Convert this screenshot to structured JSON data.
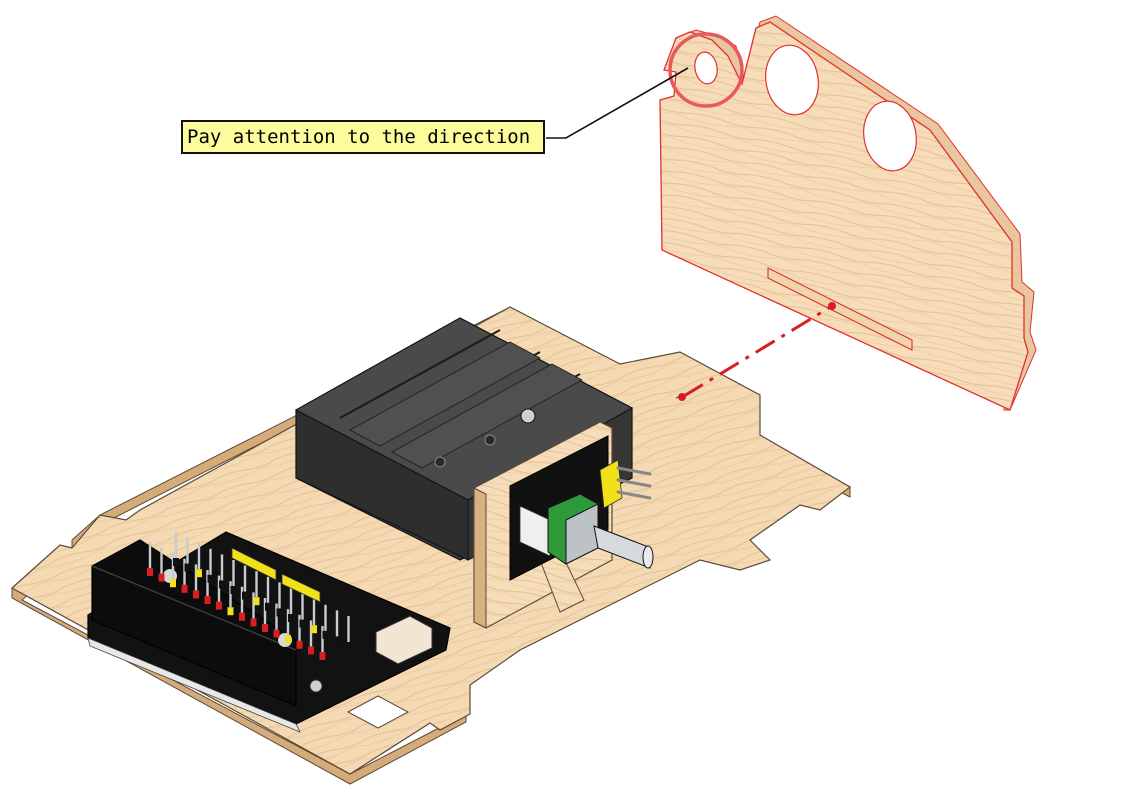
{
  "annotation": {
    "label": "Pay attention to the direction"
  },
  "colors": {
    "background": "#ffffff",
    "wood": "#f4d9b2",
    "wood_grain": "#dcb98e",
    "wood_edge": "#c9a070",
    "highlight_red": "#e03030",
    "battery_holder": "#3c3c3c",
    "board_black": "#151515",
    "pin_yellow": "#f2e01a",
    "pin_red": "#d81e1e",
    "pot_green": "#2e9a3a",
    "metal": "#bfc4c8",
    "callout_fill": "#fcfc9c"
  },
  "parts": {
    "base_plate": "wood-base-plate",
    "side_panel": "wood-side-panel",
    "battery_holder": "battery-holder",
    "expansion_board": "microbit-expansion-board",
    "potentiometer_module": "potentiometer-module",
    "support_bracket": "wood-support-bracket"
  }
}
